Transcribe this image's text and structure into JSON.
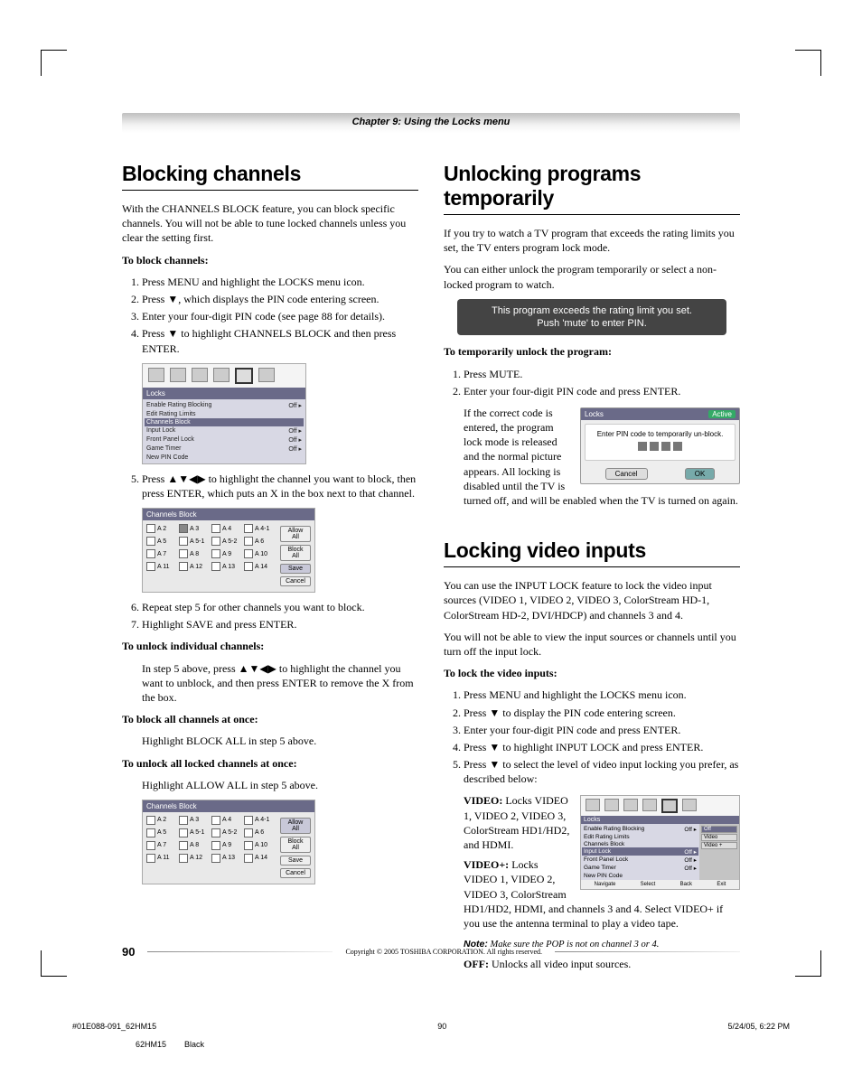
{
  "chapter_header": "Chapter 9: Using the Locks menu",
  "left": {
    "h1": "Blocking channels",
    "intro": "With the CHANNELS BLOCK feature, you can block specific channels. You will not be able to tune locked channels unless you clear the setting first.",
    "sub_block": "To block channels:",
    "steps_a": {
      "s1": "Press MENU and highlight the LOCKS menu icon.",
      "s2a": "Press ",
      "s2b": ", which displays the PIN code entering screen.",
      "s3": "Enter your four-digit PIN code (see page 88 for details).",
      "s4a": "Press ",
      "s4b": " to highlight CHANNELS BLOCK and then press ENTER."
    },
    "locks_menu": {
      "title": "Locks",
      "items": [
        {
          "label": "Enable Rating Blocking",
          "val": "Off",
          "arrow": "▸"
        },
        {
          "label": "Edit Rating Limits",
          "val": "",
          "arrow": ""
        },
        {
          "label": "Channels Block",
          "val": "",
          "arrow": "",
          "hi": true
        },
        {
          "label": "Input Lock",
          "val": "Off",
          "arrow": "▸"
        },
        {
          "label": "Front Panel Lock",
          "val": "Off",
          "arrow": "▸"
        },
        {
          "label": "Game Timer",
          "val": "Off",
          "arrow": "▸"
        },
        {
          "label": "New PIN Code",
          "val": "",
          "arrow": ""
        }
      ]
    },
    "step5a": "Press ",
    "step5b": " to highlight the channel you want to block, then press ENTER, which puts an X in the box next to that channel.",
    "cb1": {
      "title": "Channels Block",
      "rows": [
        [
          "A 2",
          "A 3",
          "A 4",
          "A 4-1"
        ],
        [
          "A 5",
          "A 5-1",
          "A 5-2",
          "A 6"
        ],
        [
          "A 7",
          "A 8",
          "A 9",
          "A 10"
        ],
        [
          "A 11",
          "A 12",
          "A 13",
          "A 14"
        ]
      ],
      "x_cell": "0,1",
      "side": [
        "Allow All",
        "Block All",
        "Save",
        "Cancel"
      ],
      "hi_btn": 2
    },
    "step6": "Repeat step 5 for other channels you want to block.",
    "step7": "Highlight SAVE and press ENTER.",
    "sub_unlock_ind": "To unlock individual channels:",
    "unlock_ind_a": "In step 5 above, press ",
    "unlock_ind_b": " to highlight the channel you want to unblock, and then press ENTER to remove the X from the box.",
    "sub_block_all": "To block all channels at once:",
    "block_all_body": "Highlight BLOCK ALL in step 5 above.",
    "sub_unlock_all": "To unlock all locked channels at once:",
    "unlock_all_body": "Highlight ALLOW ALL in step 5 above.",
    "cb2": {
      "title": "Channels Block",
      "rows": [
        [
          "A 2",
          "A 3",
          "A 4",
          "A 4-1"
        ],
        [
          "A 5",
          "A 5-1",
          "A 5-2",
          "A 6"
        ],
        [
          "A 7",
          "A 8",
          "A 9",
          "A 10"
        ],
        [
          "A 11",
          "A 12",
          "A 13",
          "A 14"
        ]
      ],
      "side": [
        "Allow All",
        "Block All",
        "Save",
        "Cancel"
      ],
      "hi_btn": 0
    }
  },
  "right": {
    "h1a": "Unlocking programs temporarily",
    "p1": "If you try to watch a TV program that exceeds the rating limits you set, the TV enters program lock mode.",
    "p2": "You can either unlock the program temporarily or select a non-locked program to watch.",
    "osd1_l1": "This program exceeds the rating limit you set.",
    "osd1_l2": "Push 'mute' to enter PIN.",
    "sub_temp": "To temporarily unlock the program:",
    "t_step1": "Press MUTE.",
    "t_step2": "Enter your four-digit PIN code and press ENTER.",
    "t_body": "If the correct code is entered, the program lock mode is released and the normal picture appears. All locking is disabled until the TV is turned off, and will be enabled when the TV is turned on again.",
    "pin_panel": {
      "title": "Locks",
      "active": "Active",
      "msg": "Enter PIN code to temporarily un-block.",
      "cancel": "Cancel",
      "ok": "OK"
    },
    "h1b": "Locking video inputs",
    "lv_p1": "You can use the INPUT LOCK feature to lock the video input sources (VIDEO 1, VIDEO 2, VIDEO 3, ColorStream HD-1, ColorStream HD-2, DVI/HDCP) and channels 3 and 4.",
    "lv_p2": "You will not be able to view the input sources or channels until you turn off the input lock.",
    "sub_lock_inputs": "To lock the video inputs:",
    "lv_s1": "Press MENU and highlight the LOCKS menu icon.",
    "lv_s2a": "Press ",
    "lv_s2b": " to display the PIN code entering screen.",
    "lv_s3": "Enter your four-digit PIN code and press ENTER.",
    "lv_s4a": "Press ",
    "lv_s4b": " to highlight INPUT LOCK and press ENTER.",
    "lv_s5a": "Press ",
    "lv_s5b": " to select the level of video input locking you prefer, as described below:",
    "desc_video_t": "VIDEO:",
    "desc_video_b": " Locks VIDEO 1, VIDEO 2, VIDEO 3, ColorStream HD1/HD2, and HDMI.",
    "desc_videop_t": "VIDEO+:",
    "desc_videop_b": " Locks VIDEO 1, VIDEO 2, VIDEO 3, ColorStream HD1/HD2, HDMI, and channels 3 and 4. Select VIDEO+ if you use the antenna terminal to play a video tape.",
    "note_label": "Note:",
    "note_body": " Make sure the POP is not on channel 3 or 4.",
    "desc_off_t": "OFF:",
    "desc_off_b": " Unlocks all video input sources.",
    "lock_shot": {
      "title": "Locks",
      "items": [
        {
          "label": "Enable Rating Blocking",
          "val": "Off",
          "arrow": "▸"
        },
        {
          "label": "Edit Rating Limits",
          "val": "",
          "arrow": ""
        },
        {
          "label": "Channels Block",
          "val": "",
          "arrow": ""
        },
        {
          "label": "Input Lock",
          "val": "Off",
          "arrow": "▸",
          "hi": true
        },
        {
          "label": "Front Panel Lock",
          "val": "Off",
          "arrow": "▸"
        },
        {
          "label": "Game Timer",
          "val": "Off",
          "arrow": "▸"
        },
        {
          "label": "New PIN Code",
          "val": "",
          "arrow": ""
        }
      ],
      "side": [
        "Off",
        "Video",
        "Video +"
      ],
      "side_hi": 0,
      "foot": [
        "Navigate",
        "Select",
        "Back",
        "Exit"
      ]
    }
  },
  "footer": {
    "page_num": "90",
    "copyright": "Copyright © 2005 TOSHIBA CORPORATION. All rights reserved.",
    "job": "#01E088-091_62HM15",
    "job_pn": "90",
    "timestamp": "5/24/05, 6:22 PM",
    "model": "62HM15",
    "color": "Black"
  }
}
